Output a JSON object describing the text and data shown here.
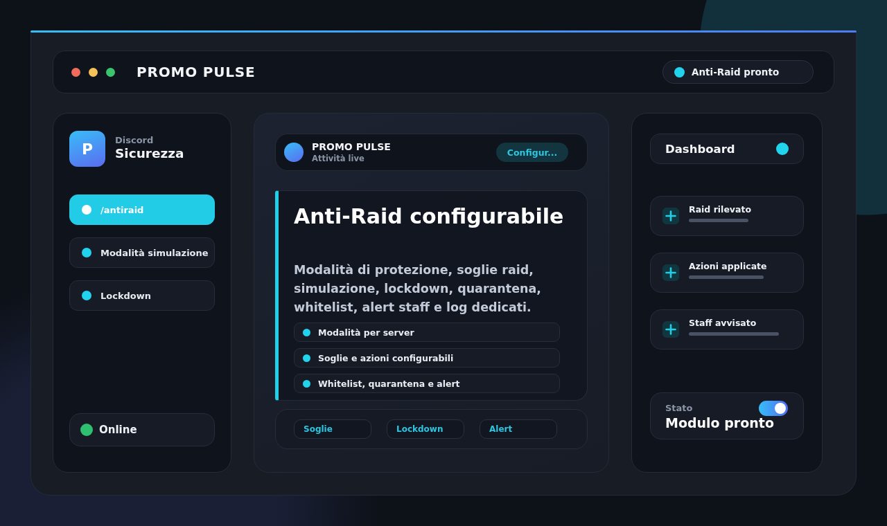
{
  "window": {
    "title": "PROMO PULSE",
    "controls": [
      {
        "color": "#f26b5b"
      },
      {
        "color": "#f5c35a"
      },
      {
        "color": "#3bc46e"
      }
    ],
    "status": "Anti-Raid pronto"
  },
  "sidebar": {
    "logo": "P",
    "subtitle": "Discord",
    "title": "Sicurezza",
    "items": [
      {
        "label": "/antiraid",
        "selected": true
      },
      {
        "label": "Modalità simulazione",
        "selected": false
      },
      {
        "label": "Lockdown",
        "selected": false
      }
    ],
    "status": "Online"
  },
  "main": {
    "header": {
      "title": "PROMO PULSE",
      "subtitle": "Attività live",
      "button": "Configur..."
    },
    "hero": {
      "title": "Anti-Raid configurabile",
      "description": "Modalità di protezione, soglie raid, simulazione, lockdown, quarantena, whitelist, alert staff e log dedicati.",
      "features": [
        "Modalità per server",
        "Soglie e azioni configurabili",
        "Whitelist, quarantena e alert"
      ]
    },
    "chips": [
      "Soglie",
      "Lockdown",
      "Alert"
    ]
  },
  "right_panel": {
    "header": "Dashboard",
    "events": [
      "Raid rilevato",
      "Azioni applicate",
      "Staff avvisato"
    ],
    "status": {
      "label": "Stato",
      "value": "Modulo pronto",
      "on": true
    }
  }
}
